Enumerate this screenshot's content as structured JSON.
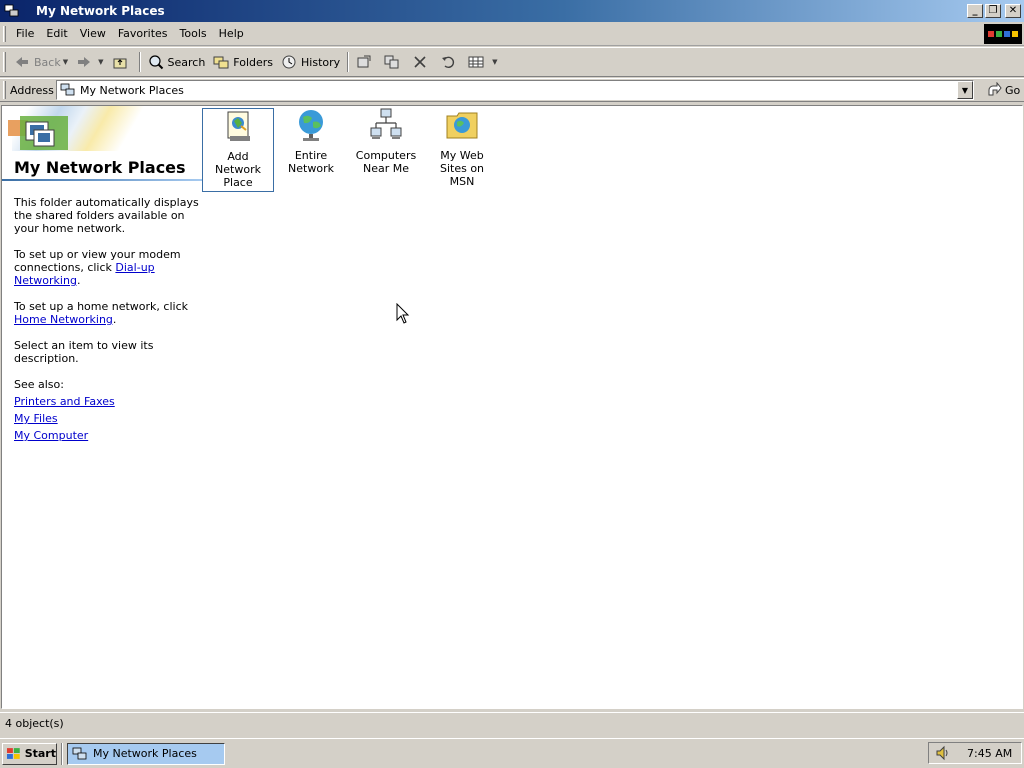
{
  "window": {
    "title": "My Network Places"
  },
  "menu": [
    "File",
    "Edit",
    "View",
    "Favorites",
    "Tools",
    "Help"
  ],
  "toolbar": {
    "back": "Back",
    "search": "Search",
    "folders": "Folders",
    "history": "History"
  },
  "address": {
    "label": "Address",
    "value": "My Network Places",
    "go": "Go"
  },
  "side": {
    "title": "My Network Places",
    "p1": "This folder automatically displays the shared folders available on your home network.",
    "p2_pre": "To set up or view your modem connections, click ",
    "p2_link": "Dial-up Networking",
    "p2_post": ".",
    "p3_pre": "To set up a home network, click ",
    "p3_link": "Home Networking",
    "p3_post": ".",
    "p4": "Select an item to view its description.",
    "see_also": "See also:",
    "links": [
      "Printers and Faxes",
      "My Files",
      "My Computer"
    ]
  },
  "items": [
    {
      "label": "Add Network Place",
      "icon": "add-network-place-icon"
    },
    {
      "label": "Entire Network",
      "icon": "globe-icon"
    },
    {
      "label": "Computers Near Me",
      "icon": "computers-icon"
    },
    {
      "label": "My Web Sites on MSN",
      "icon": "web-folder-icon"
    }
  ],
  "status": {
    "text": "4 object(s)"
  },
  "taskbar": {
    "start": "Start",
    "task": "My Network Places",
    "clock": "7:45 AM"
  }
}
